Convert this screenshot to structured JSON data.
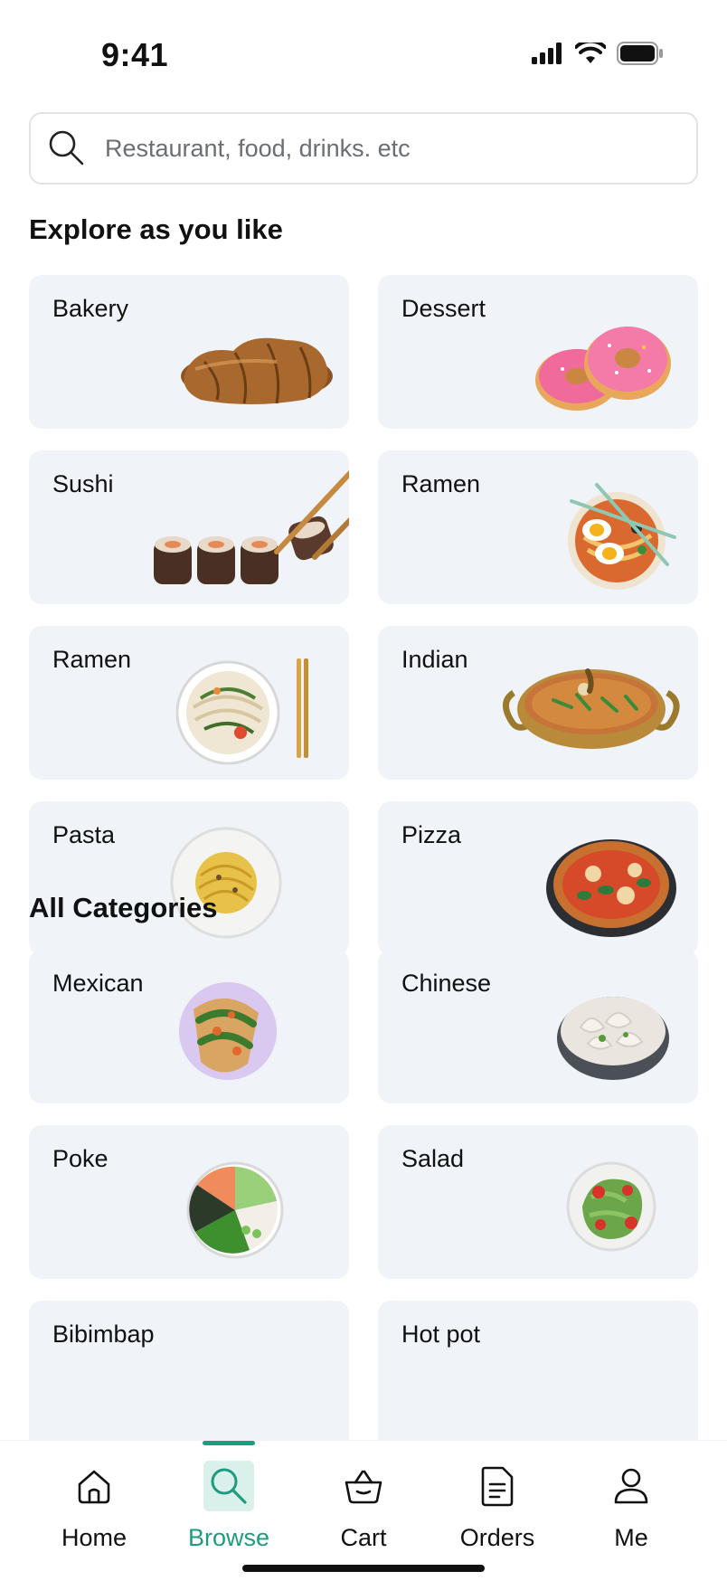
{
  "status_bar": {
    "time": "9:41"
  },
  "search": {
    "placeholder": "Restaurant, food, drinks. etc"
  },
  "explore": {
    "title": "Explore as you like",
    "items": [
      {
        "label": "Bakery",
        "icon": "croissant-image"
      },
      {
        "label": "Dessert",
        "icon": "donut-image"
      },
      {
        "label": "Sushi",
        "icon": "sushi-image"
      },
      {
        "label": "Ramen",
        "icon": "ramen-egg-bowl-image"
      },
      {
        "label": "Ramen",
        "icon": "ramen-noodle-bowl-image"
      },
      {
        "label": "Indian",
        "icon": "curry-pot-image"
      },
      {
        "label": "Pasta",
        "icon": "pasta-plate-image"
      },
      {
        "label": "Pizza",
        "icon": "pizza-image"
      }
    ]
  },
  "categories": {
    "title": "All Categories",
    "items": [
      {
        "label": "Mexican",
        "icon": "tacos-plate-image"
      },
      {
        "label": "Chinese",
        "icon": "dumplings-bowl-image"
      },
      {
        "label": "Poke",
        "icon": "poke-bowl-image"
      },
      {
        "label": "Salad",
        "icon": "salad-plate-image"
      },
      {
        "label": "Bibimbap",
        "icon": "bibimbap-image"
      },
      {
        "label": "Hot pot",
        "icon": "hot-pot-image"
      }
    ]
  },
  "nav": {
    "items": [
      {
        "label": "Home",
        "icon": "home-icon"
      },
      {
        "label": "Browse",
        "icon": "search-icon",
        "active": true
      },
      {
        "label": "Cart",
        "icon": "basket-icon"
      },
      {
        "label": "Orders",
        "icon": "document-icon"
      },
      {
        "label": "Me",
        "icon": "user-icon"
      }
    ]
  },
  "colors": {
    "accent": "#1f9c7f",
    "card_bg": "#f0f3f8",
    "border": "#e1e3e7"
  }
}
